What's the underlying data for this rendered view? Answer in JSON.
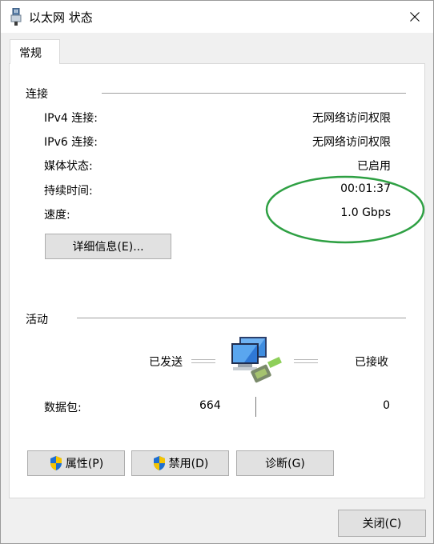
{
  "window": {
    "title": "以太网 状态"
  },
  "tabs": [
    {
      "label": "常规"
    }
  ],
  "connection": {
    "section_title": "连接",
    "rows": [
      {
        "label": "IPv4 连接:",
        "value": "无网络访问权限"
      },
      {
        "label": "IPv6 连接:",
        "value": "无网络访问权限"
      },
      {
        "label": "媒体状态:",
        "value": "已启用"
      },
      {
        "label": "持续时间:",
        "value": "00:01:37"
      },
      {
        "label": "速度:",
        "value": "1.0 Gbps"
      }
    ],
    "details_button": "详细信息(E)..."
  },
  "activity": {
    "section_title": "活动",
    "sent_label": "已发送",
    "received_label": "已接收",
    "packets_label": "数据包:",
    "packets_sent": "664",
    "packets_received": "0"
  },
  "actions": {
    "properties_button": "属性(P)",
    "disable_button": "禁用(D)",
    "diagnose_button": "诊断(G)"
  },
  "footer": {
    "close_button": "关闭(C)"
  },
  "colors": {
    "annotation_ellipse": "#2ea043",
    "button_face": "#e1e1e1",
    "shield_blue": "#1e6fd1",
    "shield_yellow": "#f5c400"
  },
  "icons": [
    "ethernet-adapter-icon",
    "close-icon",
    "uac-shield-icon",
    "network-computers-icon"
  ]
}
